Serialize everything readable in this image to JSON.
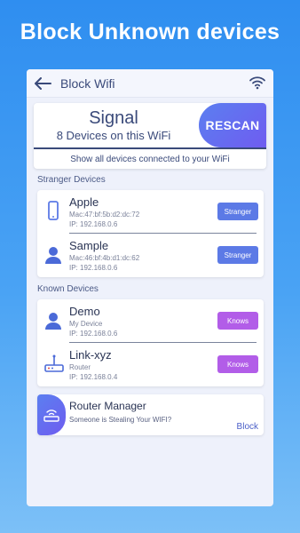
{
  "banner": {
    "title": "Block Unknown devices"
  },
  "appbar": {
    "title": "Block Wifi",
    "back_icon": "back-arrow-icon",
    "wifi_icon": "wifi-icon"
  },
  "signal": {
    "title": "Signal",
    "subtitle": "8 Devices on this WiFi",
    "rescan_label": "RESCAN",
    "footer": "Show all devices connected to your WiFi"
  },
  "stranger": {
    "label": "Stranger Devices",
    "devices": [
      {
        "name": "Apple",
        "line1": "Mac:47:bf:5b:d2:dc:72",
        "line2": "IP: 192.168.0.6",
        "button": "Stranger",
        "icon": "phone-icon"
      },
      {
        "name": "Sample",
        "line1": "Mac:46:bf:4b:d1:dc:62",
        "line2": "IP: 192.168.0.6",
        "button": "Stranger",
        "icon": "user-icon"
      }
    ]
  },
  "known": {
    "label": "Known Devices",
    "devices": [
      {
        "name": "Demo",
        "line1": "My Device",
        "line2": "IP: 192.168.0.6",
        "button": "Knows",
        "icon": "user-icon"
      },
      {
        "name": "Link-xyz",
        "line1": "Router",
        "line2": "IP: 192.168.0.4",
        "button": "Knows",
        "icon": "router-icon"
      }
    ]
  },
  "router_manager": {
    "title": "Router Manager",
    "subtitle": "Someone is Stealing Your WIFI?",
    "block_label": "Block",
    "icon": "router-icon"
  },
  "colors": {
    "background": "#3a95f2",
    "primary_dark": "#3a4a7a",
    "stranger_button": "#5c7ae6",
    "knows_button": "#b25de8"
  }
}
